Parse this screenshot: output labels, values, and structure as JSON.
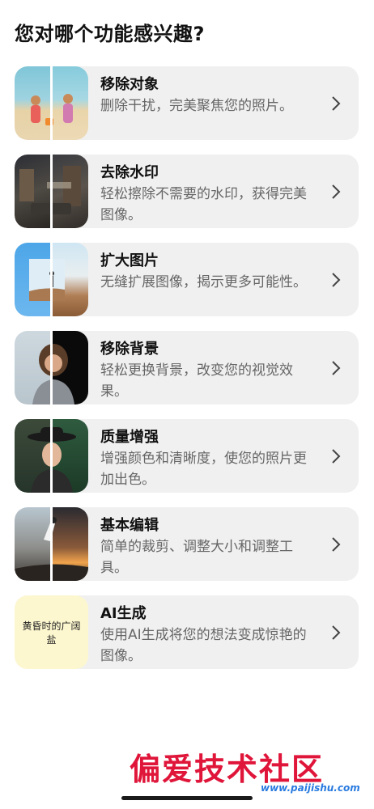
{
  "page": {
    "title": "您对哪个功能感兴趣?"
  },
  "features": [
    {
      "title": "移除对象",
      "description": "删除干扰，完美聚焦您的照片。",
      "icon": "chevron-right-icon"
    },
    {
      "title": "去除水印",
      "description": "轻松擦除不需要的水印，获得完美图像。",
      "icon": "chevron-right-icon"
    },
    {
      "title": "扩大图片",
      "description": "无缝扩展图像，揭示更多可能性。",
      "icon": "chevron-right-icon"
    },
    {
      "title": "移除背景",
      "description": "轻松更换背景，改变您的视觉效果。",
      "icon": "chevron-right-icon"
    },
    {
      "title": "质量增强",
      "description": "增强颜色和清晰度，使您的照片更加出色。",
      "icon": "chevron-right-icon"
    },
    {
      "title": "基本编辑",
      "description": "简单的裁剪、调整大小和调整工具。",
      "icon": "chevron-right-icon"
    },
    {
      "title": "AI生成",
      "description": "使用AI生成将您的想法变成惊艳的图像。",
      "icon": "chevron-right-icon",
      "thumbnail_text": "黄昏时的广阔盐"
    }
  ],
  "watermark": {
    "text": "偏爱技术社区",
    "url": "www.paijishu.com"
  }
}
